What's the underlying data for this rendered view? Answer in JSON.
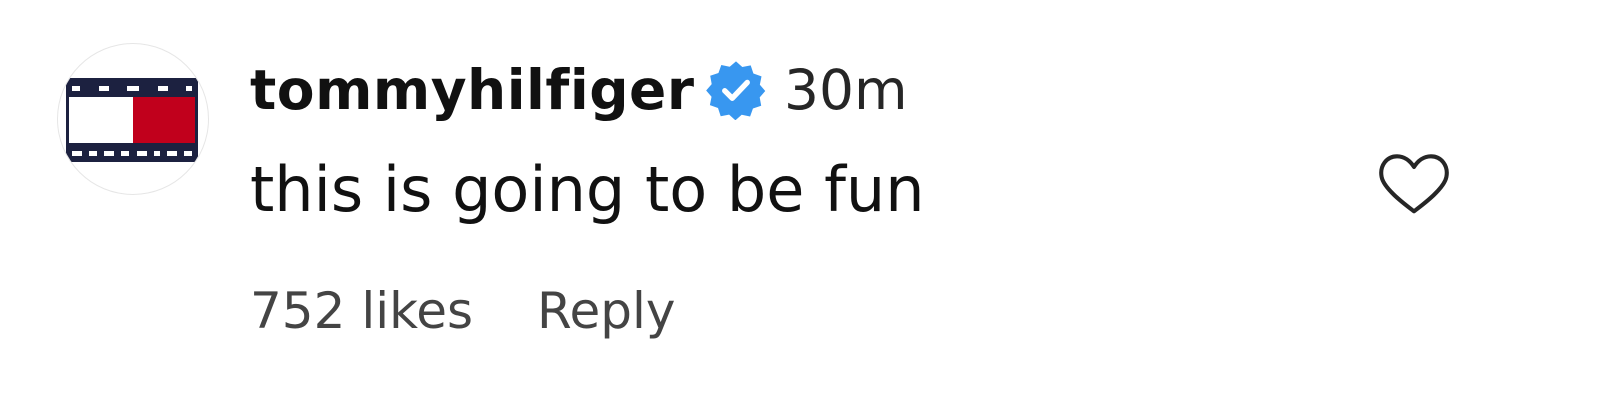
{
  "comment": {
    "username": "tommyhilfiger",
    "verified": true,
    "time": "30m",
    "text": "this is going to be fun",
    "likes": "752 likes",
    "reply_label": "Reply"
  },
  "icons": {
    "avatar": "tommy-hilfiger-flag-logo",
    "verified": "verified-badge-icon",
    "like": "heart-outline-icon"
  },
  "colors": {
    "verified_badge": "#3897f0",
    "logo_navy": "#1c2140",
    "logo_red": "#c1001c",
    "text_primary": "#111111",
    "text_secondary": "#444444"
  }
}
